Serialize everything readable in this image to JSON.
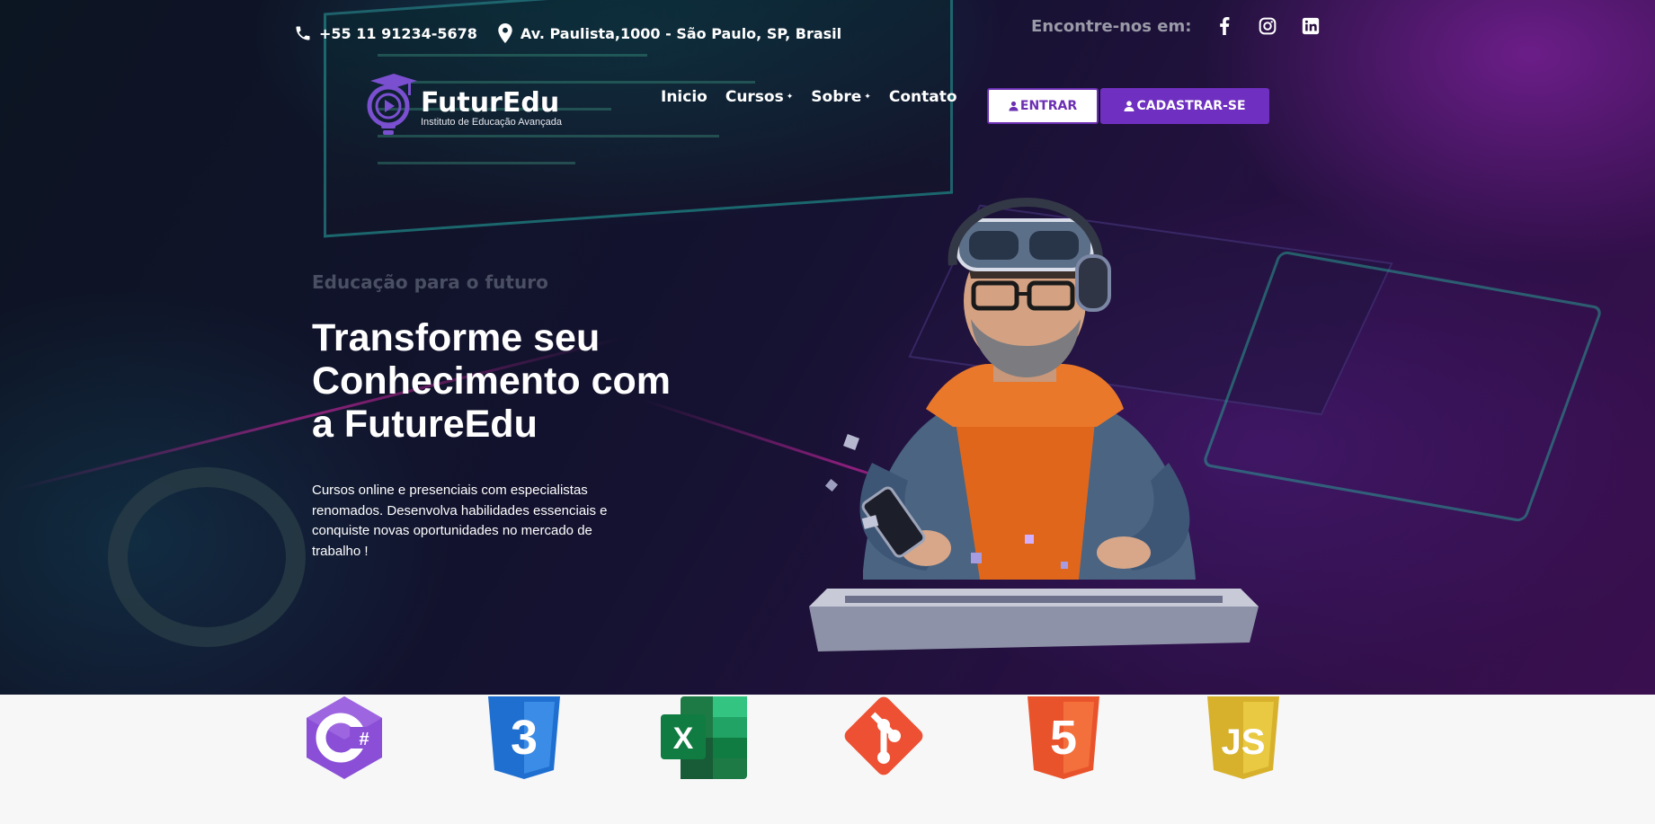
{
  "topbar": {
    "phone": "+55 11 91234-5678",
    "address": "Av. Paulista,1000 - São Paulo, SP, Brasil",
    "social_label": "Encontre-nos em:",
    "social_icons": [
      "facebook-icon",
      "instagram-icon",
      "linkedin-icon"
    ]
  },
  "brand": {
    "name": "FuturEdu",
    "tagline": "Instituto de Educação Avançada",
    "accent_color": "#7a4fd0"
  },
  "nav": {
    "items": [
      {
        "label": "Inicio",
        "has_dropdown": false
      },
      {
        "label": "Cursos",
        "has_dropdown": true
      },
      {
        "label": "Sobre",
        "has_dropdown": true
      },
      {
        "label": "Contato",
        "has_dropdown": false
      }
    ],
    "login_label": "ENTRAR",
    "signup_label": "CADASTRAR-SE"
  },
  "hero": {
    "eyebrow": "Educação para o futuro",
    "headline": "Transforme seu Conhecimento com a FutureEdu",
    "description": "Cursos online e presenciais com especialistas renomados. Desenvolva habilidades essenciais e conquiste novas oportunidades no mercado de trabalho !"
  },
  "tech_logos": [
    "csharp-icon",
    "css3-icon",
    "excel-icon",
    "git-icon",
    "html5-icon",
    "javascript-icon"
  ],
  "colors": {
    "primary_purple": "#6f2fc0",
    "csharp": "#8a4fd6",
    "css3": "#1f6fd0",
    "excel": "#1d7a45",
    "git": "#ee5033",
    "html5": "#e9532b",
    "javascript": "#e4c23a"
  }
}
